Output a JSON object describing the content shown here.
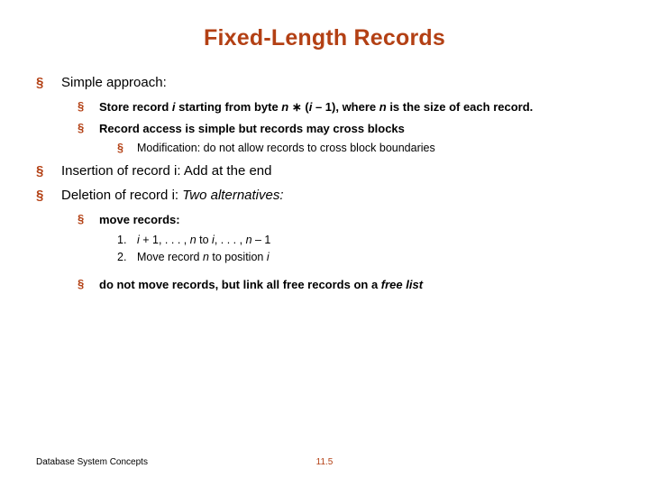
{
  "title": "Fixed-Length Records",
  "bullet_sq": "§",
  "items": {
    "simple_approach": "Simple approach:",
    "store_record_pre": "Store record ",
    "store_record_i": "i ",
    "store_record_mid1": "starting from byte ",
    "store_record_n": "n",
    "store_record_star": " ∗ ",
    "store_record_paren": "(",
    "store_record_i2": "i",
    "store_record_minus1": " – 1), where ",
    "store_record_n2": "n",
    "store_record_tail": " is the size of each record.",
    "record_access": "Record access is simple but records may cross blocks",
    "modification": "Modification: do not allow records to cross block boundaries",
    "insertion": "Insertion of record i: Add at the end",
    "deletion_pre": "Deletion of record i:",
    "deletion_tail": "  Two alternatives:",
    "move_records": "move records:",
    "alt1_num": "1.",
    "alt1_pre": " ",
    "alt1_i1": "i",
    "alt1_mid": " + 1, . . . , ",
    "alt1_n": "n",
    "alt1_to": "  to ",
    "alt1_i2": "i",
    "alt1_dots": ", . . . , ",
    "alt1_n2": "n",
    "alt1_minus": " – 1",
    "alt2_num": "2.",
    "alt2_pre": "Move record ",
    "alt2_n": "n",
    "alt2_tail": "  to position ",
    "alt2_i": "i",
    "donotmove_pre": "do not move records, but  link all free records on a ",
    "donotmove_freelist": "free list"
  },
  "footer": {
    "left": "Database System Concepts",
    "center": "11.5"
  }
}
